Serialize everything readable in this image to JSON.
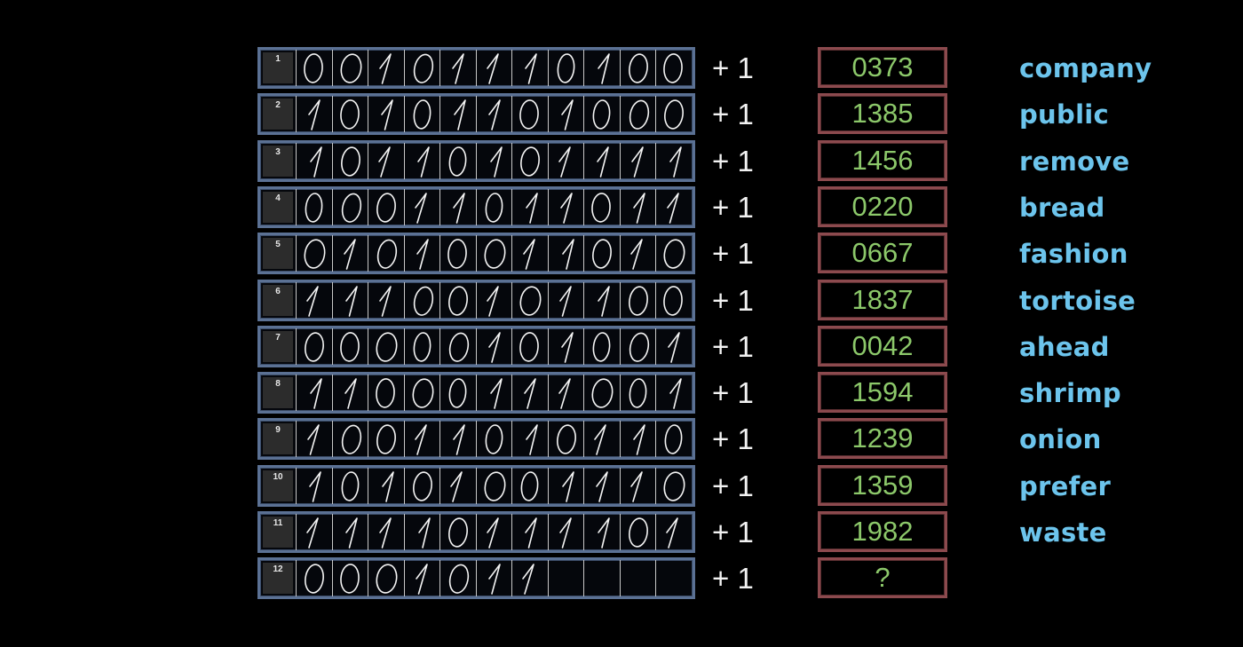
{
  "operator_label": "+ 1",
  "colors": {
    "background": "#000000",
    "binary_frame": "#5b7194",
    "number_frame": "#8c4a4e",
    "number_text": "#8cc86a",
    "word_text": "#6cc4ec",
    "digit_stroke": "#f4f4f4"
  },
  "rows": [
    {
      "index": "1",
      "digits": "00101110100",
      "number": "0373",
      "word": "company"
    },
    {
      "index": "2",
      "digits": "10101101000",
      "number": "1385",
      "word": "public"
    },
    {
      "index": "3",
      "digits": "10110101111",
      "number": "1456",
      "word": "remove"
    },
    {
      "index": "4",
      "digits": "00011011011",
      "number": "0220",
      "word": "bread"
    },
    {
      "index": "5",
      "digits": "01010011010",
      "number": "0667",
      "word": "fashion"
    },
    {
      "index": "6",
      "digits": "11100101100",
      "number": "1837",
      "word": "tortoise"
    },
    {
      "index": "7",
      "digits": "00000101001",
      "number": "0042",
      "word": "ahead"
    },
    {
      "index": "8",
      "digits": "11000111001",
      "number": "1594",
      "word": "shrimp"
    },
    {
      "index": "9",
      "digits": "10011010110",
      "number": "1239",
      "word": "onion"
    },
    {
      "index": "10",
      "digits": "10101001110",
      "number": "1359",
      "word": "prefer"
    },
    {
      "index": "11",
      "digits": "11110111101",
      "number": "1982",
      "word": "waste"
    },
    {
      "index": "12",
      "digits": "0001011",
      "number": "?",
      "word": ""
    }
  ],
  "digit_cell_count": 11
}
